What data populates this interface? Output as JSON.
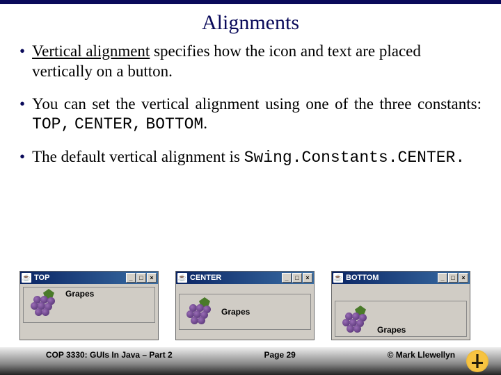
{
  "title": "Alignments",
  "bullets": {
    "b1_pre": "",
    "b1_u": "Vertical alignment",
    "b1_post": " specifies how the icon and text are placed vertically on a button.",
    "b2_pre": "You can set the vertical alignment using one of the three constants: ",
    "b2_c1": "TOP,",
    "b2_mid1": " ",
    "b2_c2": "CENTER,",
    "b2_mid2": " ",
    "b2_c3": "BOTTOM",
    "b2_post": ".",
    "b3_pre": "The default vertical alignment is ",
    "b3_c": "Swing.Constants.CENTER.",
    "b3_post": ""
  },
  "windows": {
    "w1_title": "TOP",
    "w2_title": "CENTER",
    "w3_title": "BOTTOM",
    "btn_label": "Grapes"
  },
  "footer": {
    "course": "COP 3330: GUIs In Java – Part 2",
    "page": "Page 29",
    "copyright": "© Mark Llewellyn"
  }
}
